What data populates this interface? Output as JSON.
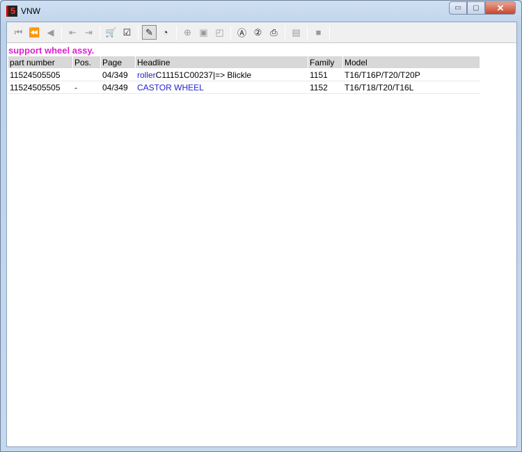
{
  "window": {
    "title": "VNW",
    "min": "▭",
    "max": "▢",
    "close": "✕"
  },
  "toolbar": [
    {
      "name": "first-icon",
      "glyph": "⏮",
      "on": false
    },
    {
      "name": "rewind-icon",
      "glyph": "⏪",
      "on": false
    },
    {
      "name": "back-icon",
      "glyph": "◀",
      "on": false
    },
    "sep",
    {
      "name": "prev-doc-icon",
      "glyph": "⇤",
      "on": false
    },
    {
      "name": "next-doc-icon",
      "glyph": "⇥",
      "on": false
    },
    "sep",
    {
      "name": "cart-icon",
      "glyph": "🛒",
      "on": true
    },
    {
      "name": "checklist-icon",
      "glyph": "☑",
      "on": true
    },
    "sep",
    {
      "name": "tool-icon",
      "glyph": "✎",
      "on": true,
      "pressed": true
    },
    {
      "name": "history-icon",
      "glyph": "◔",
      "on": true
    },
    "sep",
    {
      "name": "zoom-in-icon",
      "glyph": "⊕",
      "on": false
    },
    {
      "name": "page-icon",
      "glyph": "▣",
      "on": false
    },
    {
      "name": "page-corner-icon",
      "glyph": "◰",
      "on": false
    },
    "sep",
    {
      "name": "search-a-icon",
      "glyph": "Ⓐ",
      "on": true
    },
    {
      "name": "search-2-icon",
      "glyph": "②",
      "on": true
    },
    {
      "name": "print-icon",
      "glyph": "⎙",
      "on": true
    },
    "sep",
    {
      "name": "notes-icon",
      "glyph": "▤",
      "on": false
    },
    "sep",
    {
      "name": "stop-icon",
      "glyph": "■",
      "on": false
    },
    "sep"
  ],
  "heading": "support wheel assy.",
  "table": {
    "headers": [
      "part number",
      "Pos.",
      "Page",
      "Headline",
      "Family",
      "Model"
    ],
    "rows": [
      {
        "part": "11524505505",
        "pos": "",
        "page": "04/349",
        "head_link": "roller",
        "head_rest": "C11151C00237|=> Blickle",
        "family": "1151",
        "model": "T16/T16P/T20/T20P"
      },
      {
        "part": "11524505505",
        "pos": "-",
        "page": "04/349",
        "head_link": "CASTOR WHEEL",
        "head_rest": "",
        "family": "1152",
        "model": "T16/T18/T20/T16L"
      }
    ]
  }
}
